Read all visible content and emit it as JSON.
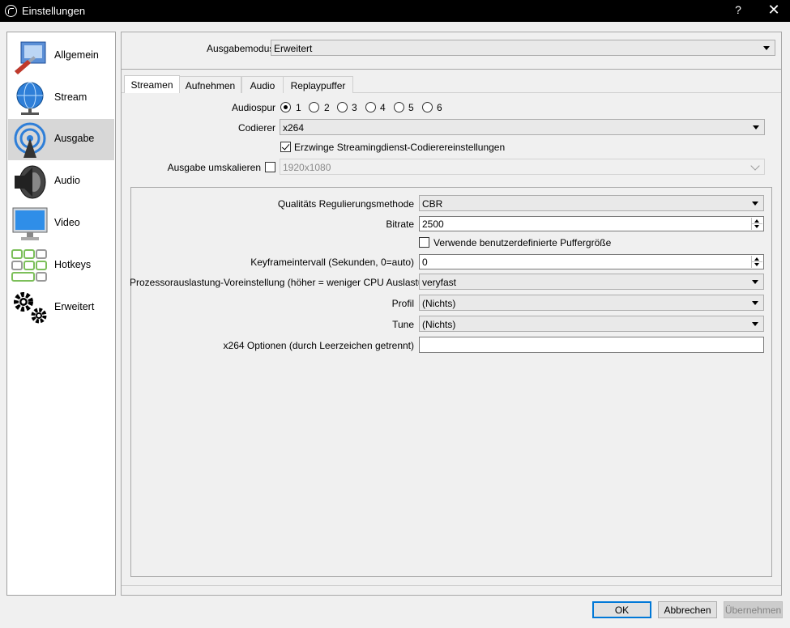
{
  "window": {
    "title": "Einstellungen",
    "help": "?",
    "close": "✕"
  },
  "sidebar": {
    "items": [
      {
        "label": "Allgemein",
        "icon": "general-tools-icon"
      },
      {
        "label": "Stream",
        "icon": "globe-network-icon"
      },
      {
        "label": "Ausgabe",
        "icon": "broadcast-antenna-icon",
        "active": true
      },
      {
        "label": "Audio",
        "icon": "speaker-icon"
      },
      {
        "label": "Video",
        "icon": "monitor-icon"
      },
      {
        "label": "Hotkeys",
        "icon": "keyboard-keys-icon"
      },
      {
        "label": "Erweitert",
        "icon": "gears-icon"
      }
    ]
  },
  "output_mode": {
    "label": "Ausgabemodus",
    "value": "Erweitert"
  },
  "tabs": [
    {
      "label": "Streamen",
      "active": true
    },
    {
      "label": "Aufnehmen"
    },
    {
      "label": "Audio"
    },
    {
      "label": "Replaypuffer"
    }
  ],
  "streaming": {
    "audio_track": {
      "label": "Audiospur",
      "options": [
        "1",
        "2",
        "3",
        "4",
        "5",
        "6"
      ],
      "selected": "1"
    },
    "encoder": {
      "label": "Codierer",
      "value": "x264"
    },
    "enforce_service": {
      "label": "Erzwinge Streamingdienst-Codierereinstellungen",
      "checked": true
    },
    "rescale": {
      "label": "Ausgabe umskalieren",
      "checked": false,
      "value": "1920x1080"
    }
  },
  "encoder_settings": {
    "rate_control": {
      "label": "Qualitäts Regulierungsmethode",
      "value": "CBR"
    },
    "bitrate": {
      "label": "Bitrate",
      "value": "2500"
    },
    "custom_buffer": {
      "label": "Verwende benutzerdefinierte Puffergröße",
      "checked": false
    },
    "keyframe": {
      "label": "Keyframeintervall (Sekunden, 0=auto)",
      "value": "0"
    },
    "preset": {
      "label": "Prozessorauslastung-Voreinstellung (höher = weniger CPU Auslastung)",
      "value": "veryfast"
    },
    "profile": {
      "label": "Profil",
      "value": "(Nichts)"
    },
    "tune": {
      "label": "Tune",
      "value": "(Nichts)"
    },
    "x264_options": {
      "label": "x264 Optionen (durch Leerzeichen getrennt)",
      "value": ""
    }
  },
  "buttons": {
    "ok": "OK",
    "cancel": "Abbrechen",
    "apply": "Übernehmen"
  }
}
